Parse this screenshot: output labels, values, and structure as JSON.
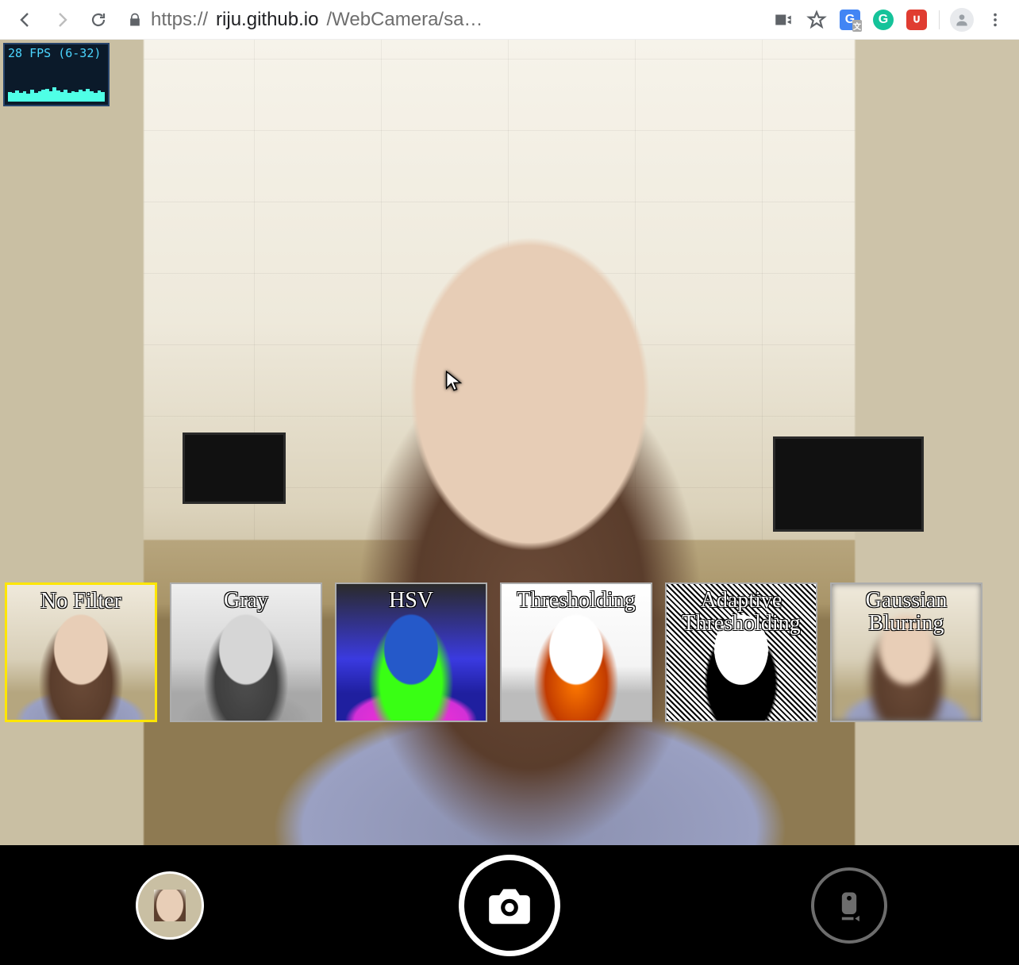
{
  "browser": {
    "url_scheme": "https://",
    "url_host": "riju.github.io",
    "url_path_truncated": "/WebCamera/sa…",
    "extensions": {
      "translate_initial": "G",
      "grammarly_initial": "G"
    }
  },
  "fps": {
    "text": "28 FPS (6-32)",
    "current": 28,
    "min": 6,
    "max": 32
  },
  "filters": [
    {
      "id": "no-filter",
      "label": "No Filter",
      "selected": true
    },
    {
      "id": "gray",
      "label": "Gray",
      "selected": false
    },
    {
      "id": "hsv",
      "label": "HSV",
      "selected": false
    },
    {
      "id": "threshold",
      "label": "Thresholding",
      "selected": false
    },
    {
      "id": "adaptive",
      "label": "Adaptive Thresholding",
      "selected": false
    },
    {
      "id": "gaussian",
      "label": "Gaussian Blurring",
      "selected": false
    }
  ],
  "icons": {
    "back": "back-icon",
    "forward": "forward-icon",
    "reload": "reload-icon",
    "lock": "lock-icon",
    "camera_indicator": "camera-indicator-icon",
    "star": "star-icon",
    "translate": "translate-extension-icon",
    "grammarly": "grammarly-extension-icon",
    "ublock": "ublock-extension-icon",
    "profile": "profile-icon",
    "kebab": "kebab-menu-icon",
    "shutter": "camera-icon",
    "switch": "switch-camera-icon",
    "cursor": "cursor-icon"
  }
}
